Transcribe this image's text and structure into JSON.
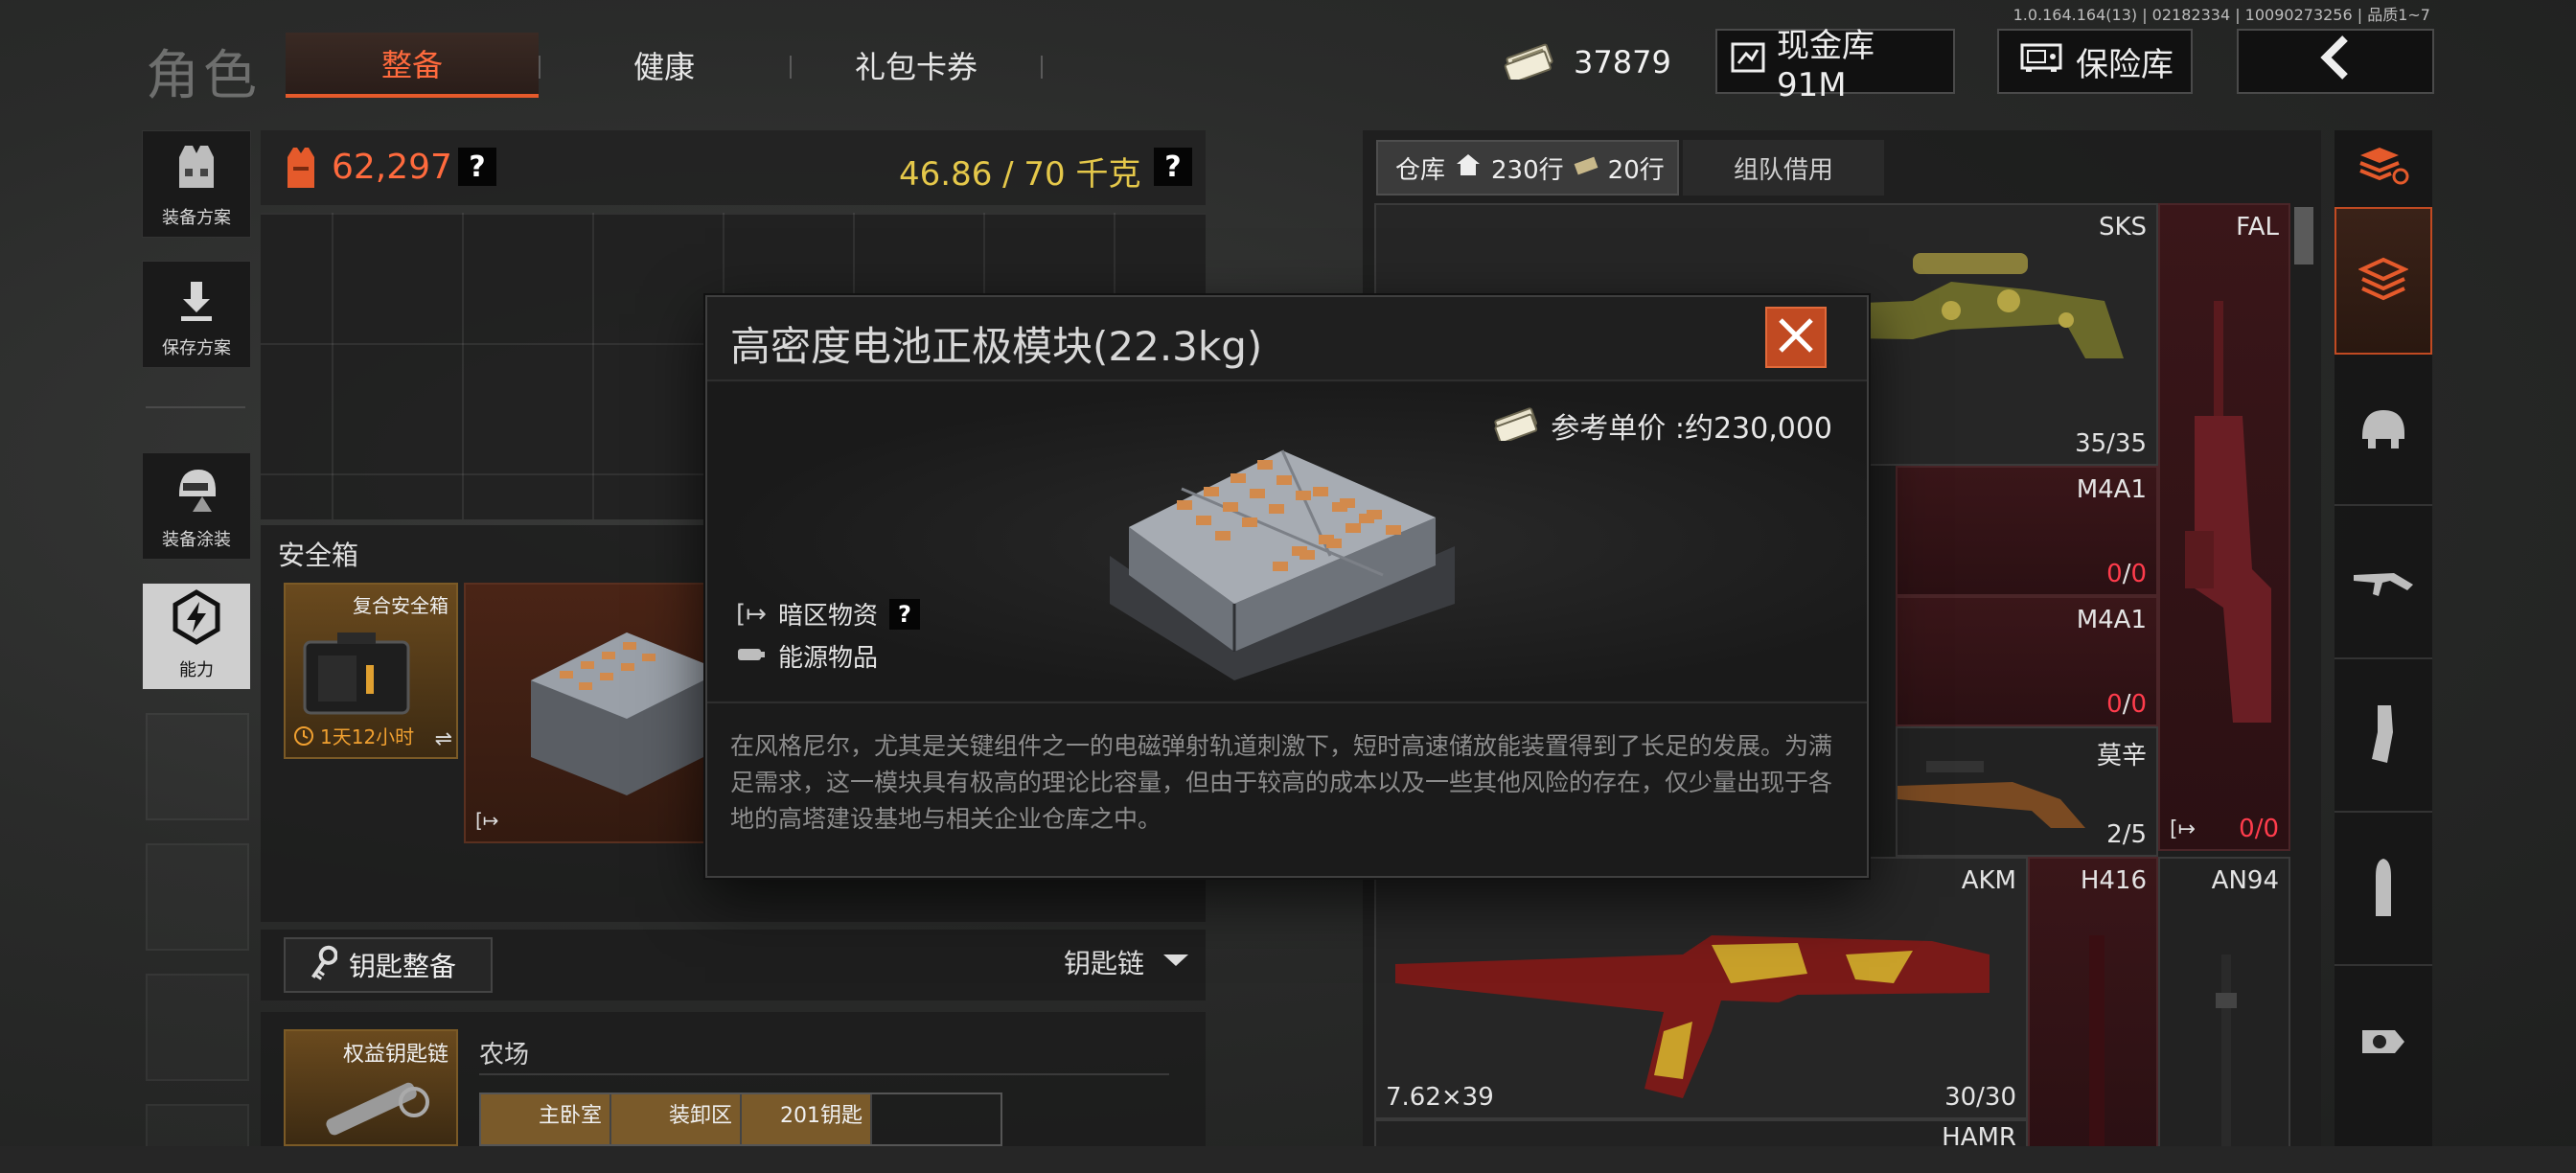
{
  "version": "1.0.164.164(13) | 02182334 | 10090273256 | 品质1~7",
  "header": {
    "title": "角色",
    "tabs": [
      {
        "label": "整备",
        "active": true
      },
      {
        "label": "健康",
        "active": false
      },
      {
        "label": "礼包卡券",
        "active": false
      }
    ],
    "currency_value": "37879",
    "cash_vault_label": "现金库 91M",
    "safe_vault_label": "保险库"
  },
  "sidebar": {
    "items": [
      {
        "label": "装备方案"
      },
      {
        "label": "保存方案"
      },
      {
        "label": "装备涂装"
      },
      {
        "label": "能力"
      }
    ]
  },
  "loadout": {
    "value": "62,297",
    "weight": "46.86 / 70 千克",
    "help": "?"
  },
  "safebox": {
    "title": "安全箱",
    "item_name": "复合安全箱",
    "timer": "1天12小时"
  },
  "keys": {
    "button_label": "钥匙整备",
    "dropdown_label": "钥匙链",
    "keychain_name": "权益钥匙链",
    "area_label": "农场",
    "key_slots": [
      "主卧室",
      "装卸区",
      "201钥匙"
    ]
  },
  "inventory": {
    "tab_warehouse": "仓库",
    "rows_house": "230行",
    "rows_ticket": "20行",
    "tab_team": "组队借用",
    "items": [
      {
        "name": "SKS",
        "ammo": "35/35"
      },
      {
        "name": "FAL",
        "ammo_cur": "0",
        "ammo_max": "0"
      },
      {
        "name": "M4A1",
        "ammo_cur": "0",
        "ammo_max": "0"
      },
      {
        "name": "M4A1",
        "ammo_cur": "0",
        "ammo_max": "0"
      },
      {
        "name": "莫辛",
        "ammo": "2/5"
      },
      {
        "name": "AKM",
        "ammo": "30/30",
        "caliber": "7.62×39"
      },
      {
        "name": "H416"
      },
      {
        "name": "AN94"
      },
      {
        "name": "HAMR"
      }
    ]
  },
  "modal": {
    "title": "高密度电池正极模块(22.3kg)",
    "price_label": "参考单价 :约230,000",
    "tags": [
      {
        "icon": "exit-icon",
        "label": "暗区物资",
        "help": "?"
      },
      {
        "icon": "battery-icon",
        "label": "能源物品"
      }
    ],
    "description": "在风格尼尔，尤其是关键组件之一的电磁弹射轨道刺激下，短时高速储放能装置得到了长足的发展。为满足需求，这一模块具有极高的理论比容量，但由于较高的成本以及一些其他风险的存在，仅少量出现于各地的高塔建设基地与相关企业仓库之中。"
  },
  "colors": {
    "accent": "#e55a2b",
    "gold": "#e5c84a",
    "red_zero": "#ff3c4c"
  }
}
